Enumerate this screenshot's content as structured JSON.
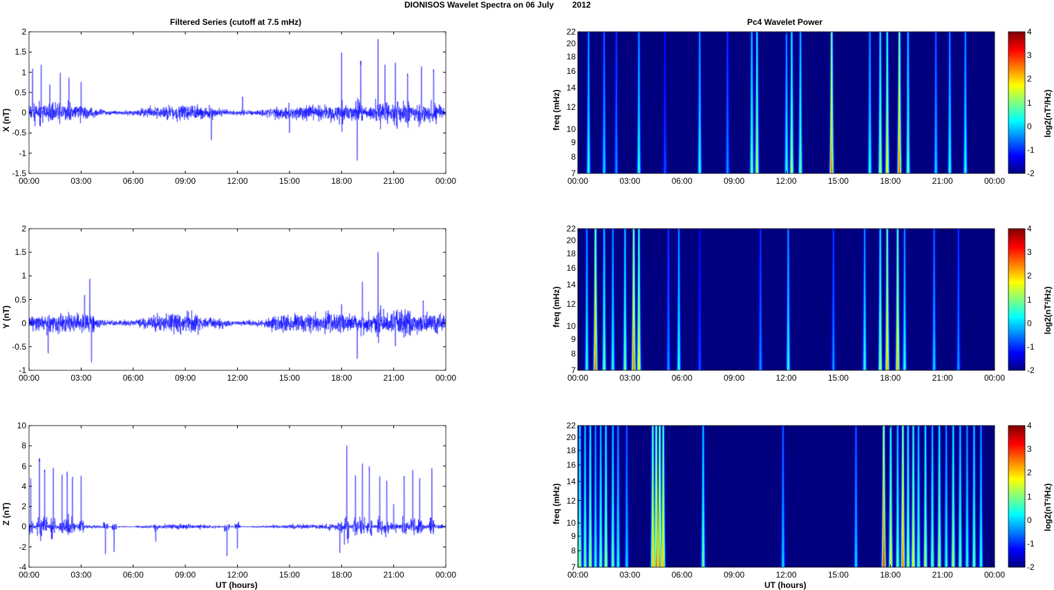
{
  "title": "DIONISOS Wavelet Spectra on 06 July",
  "year": "2012",
  "colors": {
    "trace": "#0000ff",
    "bg": "#00008f"
  },
  "chart_data": [
    {
      "type": "line",
      "title": "Filtered Series (cutoff at 7.5 mHz)",
      "panels": [
        {
          "ylabel": "X (nT)",
          "ylim": [
            -1.5,
            2
          ],
          "yticks": [
            "-1.5",
            "-1",
            "-0.5",
            "0",
            "0.5",
            "1",
            "1.5",
            "2"
          ],
          "noise": 0.12,
          "spikes": [
            [
              0.2,
              1.1
            ],
            [
              0.7,
              1.2
            ],
            [
              1.2,
              0.7
            ],
            [
              1.8,
              1.0
            ],
            [
              2.3,
              0.9
            ],
            [
              3.0,
              0.8
            ],
            [
              10.5,
              -0.7
            ],
            [
              12.3,
              0.4
            ],
            [
              15.0,
              -0.5
            ],
            [
              18.0,
              1.5
            ],
            [
              18.9,
              -1.2
            ],
            [
              19.1,
              1.3
            ],
            [
              20.1,
              1.9
            ],
            [
              20.5,
              1.2
            ],
            [
              21.1,
              1.3
            ],
            [
              21.2,
              -0.4
            ],
            [
              21.8,
              1.0
            ],
            [
              22.6,
              1.2
            ],
            [
              23.3,
              1.1
            ]
          ]
        },
        {
          "ylabel": "Y (nT)",
          "ylim": [
            -1,
            2
          ],
          "yticks": [
            "-1",
            "-0.5",
            "0",
            "0.5",
            "1",
            "1.5",
            "2"
          ],
          "noise": 0.13,
          "spikes": [
            [
              1.1,
              -0.65
            ],
            [
              3.2,
              0.6
            ],
            [
              3.5,
              0.85
            ],
            [
              3.6,
              -0.85
            ],
            [
              18.0,
              0.4
            ],
            [
              18.9,
              -0.8
            ],
            [
              19.2,
              0.9
            ],
            [
              20.1,
              1.6
            ],
            [
              21.1,
              1.1
            ],
            [
              21.1,
              -0.5
            ],
            [
              22.7,
              0.5
            ]
          ]
        },
        {
          "ylabel": "Z (nT)",
          "ylim": [
            -4,
            10
          ],
          "yticks": [
            "-4",
            "-2",
            "0",
            "2",
            "4",
            "6",
            "8",
            "10"
          ],
          "noise": 0.15,
          "spikes": [
            [
              0.1,
              4.8
            ],
            [
              0.6,
              6.9
            ],
            [
              0.9,
              5.8
            ],
            [
              1.4,
              6.2
            ],
            [
              1.9,
              5.3
            ],
            [
              2.2,
              5.5
            ],
            [
              2.5,
              5.0
            ],
            [
              3.0,
              5.2
            ],
            [
              4.4,
              -2.8
            ],
            [
              4.9,
              -2.5
            ],
            [
              7.3,
              -1.5
            ],
            [
              11.4,
              -2.9
            ],
            [
              12.0,
              -2.2
            ],
            [
              17.9,
              -2.8
            ],
            [
              18.3,
              8.4
            ],
            [
              18.8,
              5.3
            ],
            [
              19.2,
              6.5
            ],
            [
              19.6,
              6.0
            ],
            [
              20.2,
              5.0
            ],
            [
              20.6,
              4.9
            ],
            [
              21.0,
              2.3
            ],
            [
              21.6,
              5.3
            ],
            [
              22.1,
              5.7
            ],
            [
              22.5,
              5.0
            ],
            [
              23.2,
              6.0
            ]
          ]
        }
      ]
    },
    {
      "type": "heatmap",
      "title": "Pc4 Wavelet Power",
      "ylabel": "freq (mHz)",
      "xlabel": "UT (hours)",
      "yticks": [
        "7",
        "8",
        "9",
        "10",
        "12",
        "14",
        "16",
        "18",
        "20",
        "22"
      ],
      "ylim": [
        7,
        22
      ],
      "clim": [
        -2,
        4
      ],
      "cbar_ticks": [
        "-2",
        "-1",
        "0",
        "1",
        "2",
        "3",
        "4"
      ],
      "cbar_label": "log2(nT²/Hz)",
      "xticks": [
        "00:00",
        "03:00",
        "06:00",
        "09:00",
        "12:00",
        "15:00",
        "18:00",
        "21:00",
        "00:00"
      ],
      "panels": [
        {
          "bursts": [
            [
              0.6,
              1
            ],
            [
              1.5,
              0.5
            ],
            [
              2.2,
              0
            ],
            [
              3.5,
              1
            ],
            [
              5.0,
              -0.5
            ],
            [
              7.0,
              1
            ],
            [
              8.6,
              0
            ],
            [
              10.0,
              1.5
            ],
            [
              10.3,
              2
            ],
            [
              12.0,
              1
            ],
            [
              12.3,
              2
            ],
            [
              12.8,
              1.5
            ],
            [
              14.6,
              3.5
            ],
            [
              16.8,
              1
            ],
            [
              17.4,
              2
            ],
            [
              17.8,
              2.5
            ],
            [
              18.5,
              3.5
            ],
            [
              19.0,
              1.5
            ],
            [
              20.6,
              0.5
            ],
            [
              21.4,
              1
            ],
            [
              22.3,
              1
            ]
          ]
        },
        {
          "bursts": [
            [
              0.5,
              1
            ],
            [
              1.0,
              3.5
            ],
            [
              1.5,
              1.5
            ],
            [
              2.0,
              1
            ],
            [
              2.7,
              1.5
            ],
            [
              3.2,
              3.5
            ],
            [
              3.5,
              2.5
            ],
            [
              5.2,
              0
            ],
            [
              5.8,
              1
            ],
            [
              7.0,
              -0.5
            ],
            [
              10.5,
              0
            ],
            [
              12.1,
              1
            ],
            [
              14.7,
              0
            ],
            [
              16.5,
              1
            ],
            [
              17.4,
              2
            ],
            [
              17.8,
              3
            ],
            [
              18.4,
              3
            ],
            [
              18.8,
              1
            ],
            [
              20.5,
              0.5
            ],
            [
              21.9,
              0
            ]
          ]
        },
        {
          "bursts": [
            [
              0.1,
              2
            ],
            [
              0.4,
              1.5
            ],
            [
              0.7,
              2
            ],
            [
              1.0,
              1
            ],
            [
              1.3,
              1.5
            ],
            [
              1.6,
              2
            ],
            [
              2.0,
              1.5
            ],
            [
              2.3,
              1
            ],
            [
              2.8,
              0.5
            ],
            [
              4.3,
              3
            ],
            [
              4.5,
              3.5
            ],
            [
              4.7,
              3.5
            ],
            [
              4.9,
              3
            ],
            [
              7.2,
              1.5
            ],
            [
              11.8,
              0.5
            ],
            [
              16.0,
              0.5
            ],
            [
              17.6,
              4
            ],
            [
              18.0,
              2.5
            ],
            [
              18.4,
              1.5
            ],
            [
              18.7,
              3.5
            ],
            [
              19.0,
              2
            ],
            [
              19.3,
              2.5
            ],
            [
              19.6,
              1.5
            ],
            [
              20.0,
              2
            ],
            [
              20.4,
              1.5
            ],
            [
              20.8,
              2
            ],
            [
              21.2,
              1
            ],
            [
              21.6,
              2
            ],
            [
              22.0,
              1.5
            ],
            [
              22.4,
              1
            ],
            [
              22.8,
              1.5
            ],
            [
              23.2,
              1
            ]
          ]
        }
      ]
    }
  ],
  "left_title": "Filtered Series (cutoff at 7.5 mHz)",
  "right_title": "Pc4 Wavelet Power",
  "xlabel": "UT (hours)"
}
